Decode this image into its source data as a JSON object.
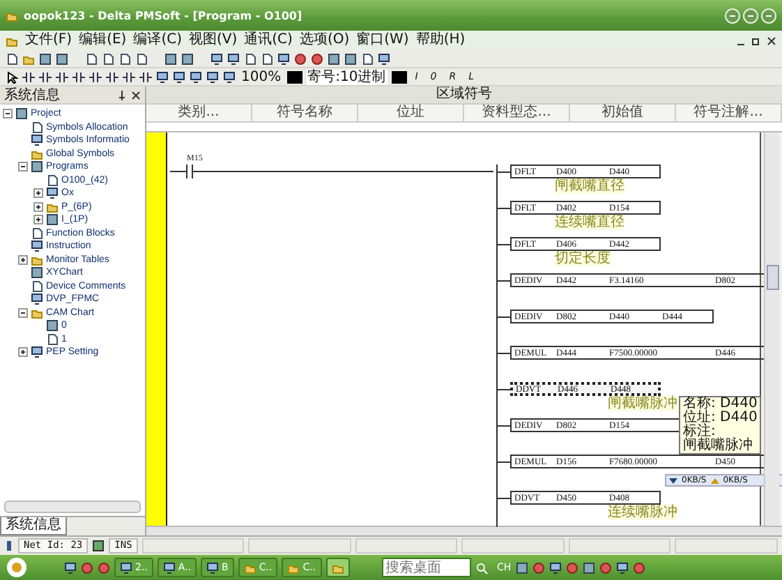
{
  "window": {
    "title": "oopok123 - Delta PMSoft - [Program - O100]"
  },
  "menu": [
    "文件(F)",
    "编辑(E)",
    "编译(C)",
    "视图(V)",
    "通讯(C)",
    "选项(O)",
    "窗口(W)",
    "帮助(H)"
  ],
  "format_bar": {
    "zoom": "100%",
    "number_format": "寄号:10进制",
    "letters": [
      "I",
      "0",
      "R",
      "L"
    ]
  },
  "sidebar": {
    "title": "系统信息",
    "tab": "系统信息",
    "tree": [
      {
        "label": "Project",
        "expanded": true,
        "children": [
          {
            "label": "Symbols Allocation"
          },
          {
            "label": "Symbols Informatio"
          },
          {
            "label": "Global Symbols"
          },
          {
            "label": "Programs",
            "expanded": true,
            "children": [
              {
                "label": "O100_(42)"
              },
              {
                "label": "Ox",
                "expanded": false
              },
              {
                "label": "P_(6P)",
                "expanded": false
              },
              {
                "label": "I_(1P)",
                "expanded": false
              }
            ]
          },
          {
            "label": "Function Blocks"
          },
          {
            "label": "Instruction"
          },
          {
            "label": "Monitor Tables",
            "expanded": false
          },
          {
            "label": "XYChart"
          },
          {
            "label": "Device Comments"
          },
          {
            "label": "DVP_FPMC"
          },
          {
            "label": "CAM Chart",
            "expanded": true,
            "children": [
              {
                "label": "0"
              },
              {
                "label": "1"
              }
            ]
          },
          {
            "label": "PEP Setting",
            "expanded": false
          }
        ]
      }
    ]
  },
  "symbol_table": {
    "title": "区域符号",
    "columns": [
      "类别...",
      "符号名称",
      "位址",
      "资料型态...",
      "初始值",
      "符号注解..."
    ]
  },
  "ladder": {
    "contact": "M15",
    "rungs": [
      {
        "op": "DFLT",
        "kind": "pair",
        "selected": false,
        "args": [
          {
            "text": "D400",
            "comment": "闸截嘴直径"
          },
          {
            "text": "D440"
          }
        ]
      },
      {
        "op": "DFLT",
        "kind": "pair",
        "selected": false,
        "args": [
          {
            "text": "D402",
            "comment": "连续嘴直径"
          },
          {
            "text": "D154"
          }
        ]
      },
      {
        "op": "DFLT",
        "kind": "pair",
        "selected": false,
        "args": [
          {
            "text": "D406",
            "comment": "切定长度"
          },
          {
            "text": "D442"
          }
        ]
      },
      {
        "op": "DEDIV",
        "kind": "wide",
        "selected": false,
        "args": [
          {
            "text": "D442"
          },
          {
            "text": "F3.14160"
          },
          {
            "text": "D802"
          }
        ]
      },
      {
        "op": "DEDIV",
        "kind": "triple",
        "selected": false,
        "args": [
          {
            "text": "D802"
          },
          {
            "text": "D440"
          },
          {
            "text": "D444"
          }
        ]
      },
      {
        "op": "DEMUL",
        "kind": "wide",
        "selected": false,
        "args": [
          {
            "text": "D444"
          },
          {
            "text": "F7500.00000"
          },
          {
            "text": "D446"
          }
        ]
      },
      {
        "op": "DDVT",
        "kind": "pair",
        "selected": true,
        "args": [
          {
            "text": "D446"
          },
          {
            "text": "D448",
            "comment": "闸截嘴脉冲"
          }
        ]
      },
      {
        "op": "DEDIV",
        "kind": "triple",
        "selected": false,
        "args": [
          {
            "text": "D802"
          },
          {
            "text": "D154"
          }
        ]
      },
      {
        "op": "DEMUL",
        "kind": "wide",
        "selected": false,
        "args": [
          {
            "text": "D156"
          },
          {
            "text": "F7680.00000"
          },
          {
            "text": "D450"
          }
        ]
      },
      {
        "op": "DDVT",
        "kind": "pair",
        "selected": false,
        "args": [
          {
            "text": "D450"
          },
          {
            "text": "D408",
            "comment": "连续嘴脉冲"
          }
        ]
      }
    ]
  },
  "tooltip": [
    "名称: D440",
    "位址: D440",
    "标注:",
    "闸截嘴脉冲"
  ],
  "net_speed": [
    "0KB/S",
    "0KB/S"
  ],
  "status_bar": {
    "net_id": "Net Id: 23",
    "mode": "INS"
  },
  "taskbar": {
    "tasks": [
      "2..",
      "A..",
      "B",
      "C..",
      "C.."
    ],
    "search": {
      "placeholder": "搜索桌面"
    },
    "language": "CH"
  }
}
